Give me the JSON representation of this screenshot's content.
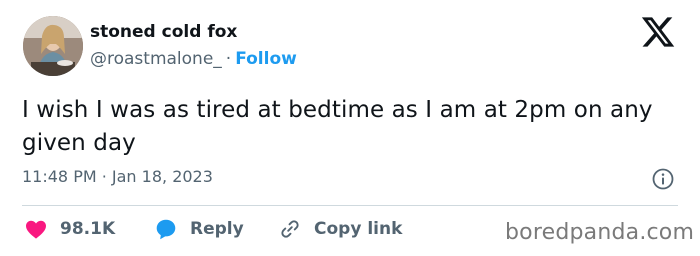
{
  "author": {
    "display_name": "stoned cold fox",
    "handle": "@roastmalone_",
    "separator": "·",
    "follow_label": "Follow"
  },
  "tweet": {
    "text": "I wish I was as tired at bedtime as I am at 2pm on any given day",
    "timestamp": "11:48 PM · Jan 18, 2023"
  },
  "actions": {
    "likes_count": "98.1K",
    "reply_label": "Reply",
    "copy_link_label": "Copy link"
  },
  "icons": {
    "logo": "x-logo-icon",
    "info": "info-icon",
    "like": "heart-icon",
    "reply": "speech-bubble-icon",
    "copy": "link-icon"
  },
  "colors": {
    "accent": "#1d9bf0",
    "like": "#f91880",
    "text": "#0f1419",
    "muted": "#536471"
  },
  "watermark": "boredpanda.com"
}
